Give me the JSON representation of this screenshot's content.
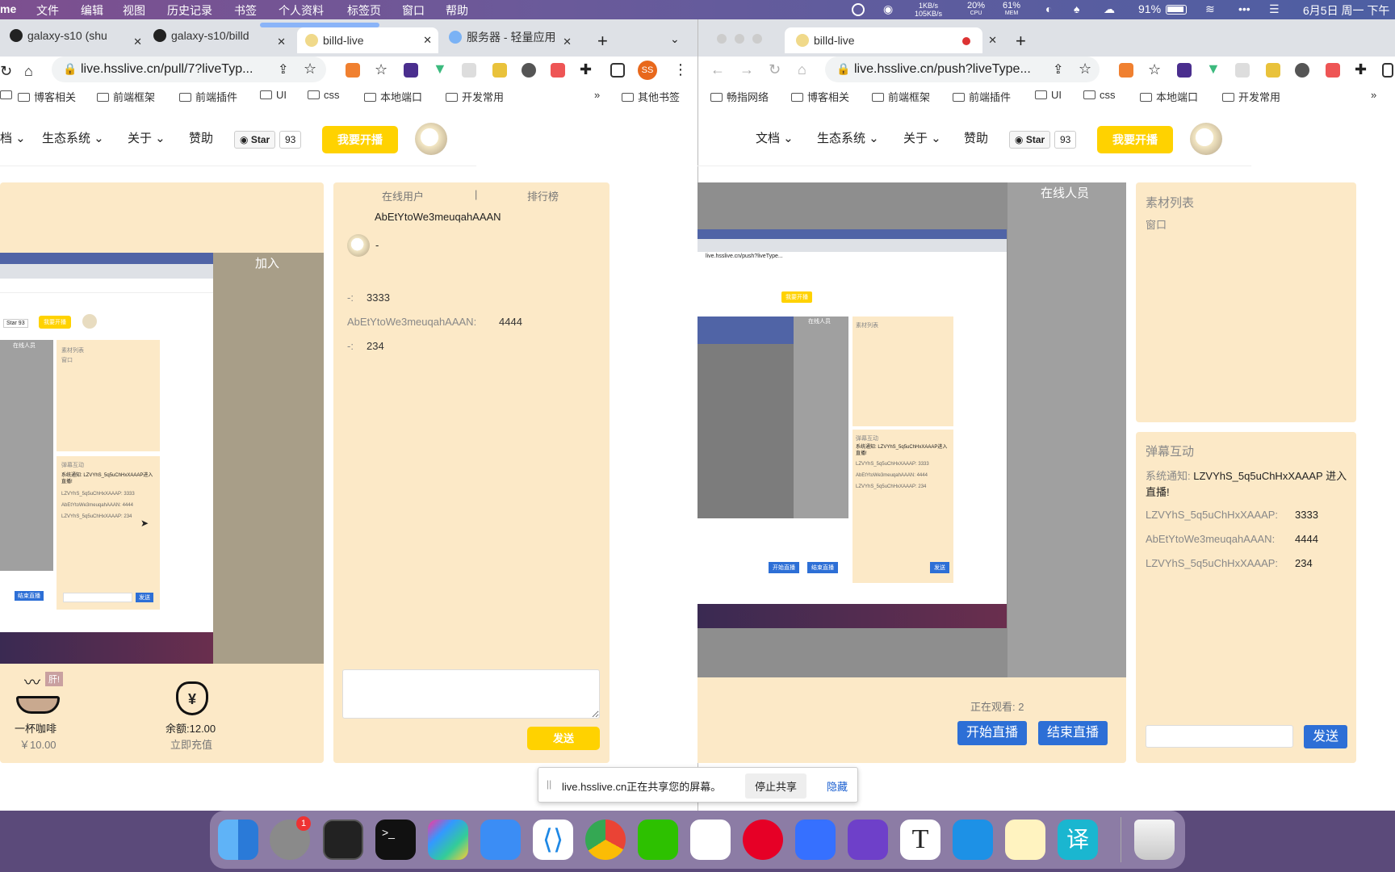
{
  "menubar": {
    "app": "me",
    "items": [
      "文件",
      "编辑",
      "视图",
      "历史记录",
      "书签",
      "个人资料",
      "标签页",
      "窗口",
      "帮助"
    ],
    "net_up": "1KB/s",
    "net_down": "105KB/s",
    "cpu_pct": "20%",
    "cpu_label": "CPU",
    "mem_pct": "61%",
    "mem_label": "MEM",
    "battery": "91%",
    "clock": "6月5日 周一  下午"
  },
  "left_window": {
    "tabs": [
      {
        "title": "galaxy-s10 (shu",
        "active": false
      },
      {
        "title": "galaxy-s10/billd",
        "active": false
      },
      {
        "title": "billd-live",
        "active": true
      },
      {
        "title": "服务器 - 轻量应用",
        "active": false
      }
    ],
    "url": "live.hsslive.cn/pull/7?liveTyp...",
    "profile_badge": "SS",
    "bookmarks": [
      "博客相关",
      "前端框架",
      "前端插件",
      "UI",
      "css",
      "本地端口",
      "开发常用"
    ],
    "bookmarks_more": "»",
    "other_bookmarks": "其他书签",
    "nav": [
      "档",
      "生态系统",
      "关于",
      "赞助"
    ],
    "star_label": "Star",
    "star_count": "93",
    "live_button": "我要开播",
    "video_overlay": "加入",
    "gift1_badge": "肝!",
    "gift1_name": "一杯咖啡",
    "gift1_price": "￥10.00",
    "balance": "余额:12.00",
    "recharge": "立即充值",
    "side_tabs": [
      "在线用户",
      "|",
      "排行榜"
    ],
    "online_user": "AbEtYtoWe3meuqahAAAN",
    "online_user_name": "-",
    "messages": [
      {
        "user": "-:",
        "text": "3333"
      },
      {
        "user": "AbEtYtoWe3meuqahAAAN:",
        "text": "4444"
      },
      {
        "user": "-:",
        "text": "234"
      }
    ],
    "input_value": "",
    "send": "发送",
    "inner": {
      "online_header": "在线人员",
      "material": "素材列表",
      "window": "窗口",
      "danmu": "弹幕互动",
      "sys": "系统通知: LZVYhS_5q5uChHxXAAAP进入直播!",
      "m1": "LZVYhS_5q5uChHxXAAAP: 3333",
      "m2": "AbEtYtoWe3meuqahAAAN: 4444",
      "m3": "LZVYhS_5q5uChHxXAAAP: 234",
      "start": "开始直播",
      "end": "结束直播",
      "send": "发送",
      "star": "Star",
      "count": "93",
      "live": "我要开播"
    }
  },
  "right_window": {
    "tab": "billd-live",
    "url": "live.hsslive.cn/push?liveType...",
    "bookmarks": [
      "畅指网络",
      "博客相关",
      "前端框架",
      "前端插件",
      "UI",
      "css",
      "本地端口",
      "开发常用"
    ],
    "bookmarks_more": "»",
    "nav": [
      "文档",
      "生态系统",
      "关于",
      "赞助"
    ],
    "star_label": "Star",
    "star_count": "93",
    "live_button": "我要开播",
    "online_header": "在线人员",
    "watching": "正在观看: 2",
    "start_live": "开始直播",
    "end_live": "结束直播",
    "material_title": "素材列表",
    "material_item": "窗口",
    "danmu_title": "弹幕互动",
    "system_notice": "系统通知:",
    "system_user": "LZVYhS_5q5uChHxXAAAP",
    "system_tail": "进入直播!",
    "messages": [
      {
        "user": "LZVYhS_5q5uChHxXAAAP:",
        "text": "3333"
      },
      {
        "user": "AbEtYtoWe3meuqahAAAN:",
        "text": "4444"
      },
      {
        "user": "LZVYhS_5q5uChHxXAAAP:",
        "text": "234"
      }
    ],
    "send": "发送"
  },
  "share_bar": {
    "text": "live.hsslive.cn正在共享您的屏幕。",
    "stop": "停止共享",
    "hide": "隐藏"
  },
  "dock": {
    "badge": "1",
    "icons": [
      "finder-icon",
      "system-preferences-icon",
      "activity-monitor-icon",
      "terminal-icon",
      "launchpad-icon",
      "clash-icon",
      "vscode-icon",
      "chrome-icon",
      "wechat-icon",
      "qq-icon",
      "netease-music-icon",
      "feishu-icon",
      "github-desktop-icon",
      "typora-icon",
      "docker-icon",
      "billd-icon",
      "translate-icon",
      "trash-icon"
    ]
  }
}
